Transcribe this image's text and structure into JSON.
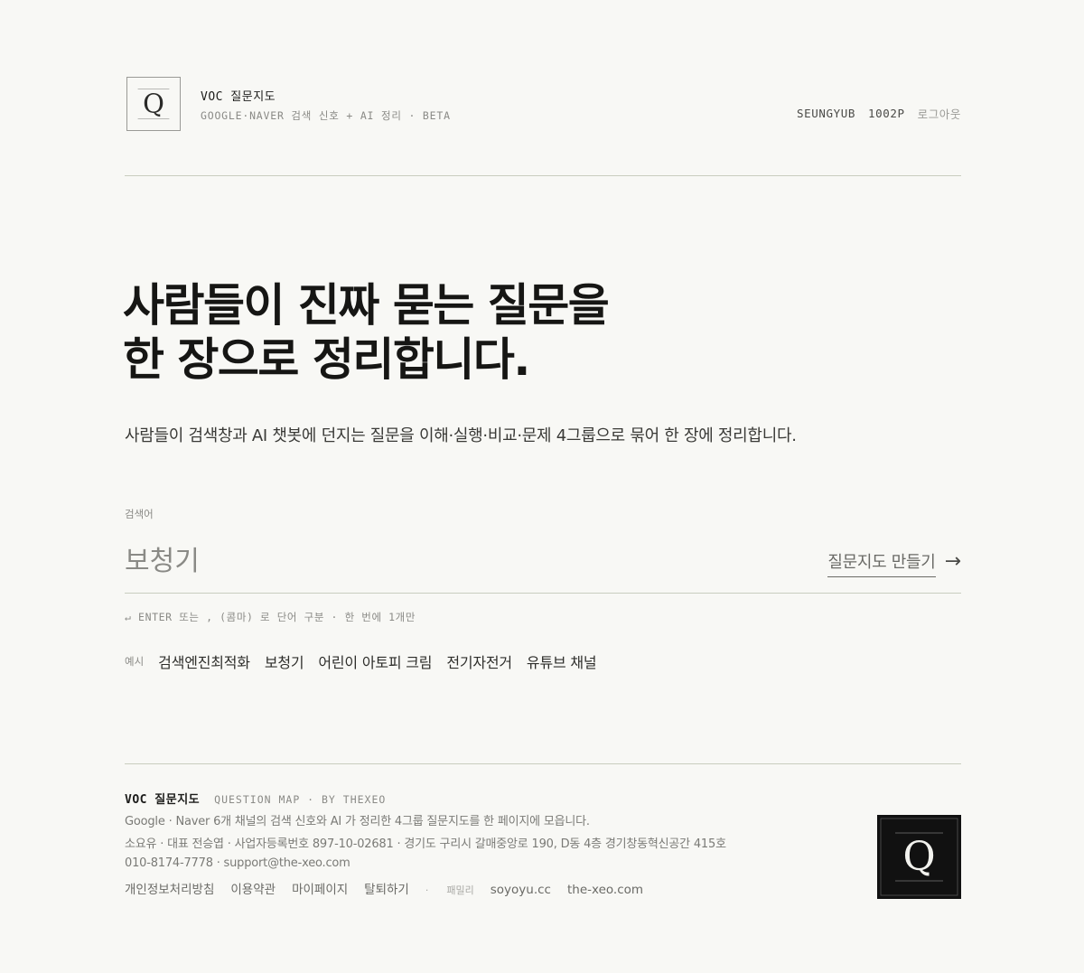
{
  "header": {
    "brand_title": "VOC  질문지도",
    "brand_subtitle": "GOOGLE·NAVER 검색 신호 + AI 정리 · BETA",
    "user_name": "SEUNGYUB",
    "user_points": "1002P",
    "logout_label": "로그아웃",
    "logo_letter": "Q"
  },
  "hero": {
    "title_line1": "사람들이 진짜 묻는 질문을",
    "title_line2": "한 장으로 정리합니다.",
    "description": "사람들이 검색창과 AI 챗봇에 던지는 질문을 이해·실행·비교·문제 4그룹으로 묶어 한 장에 정리합니다."
  },
  "search": {
    "label": "검색어",
    "value": "보청기",
    "button_label": "질문지도 만들기",
    "button_arrow": "→",
    "hint": "↵ ENTER 또는 , (콤마) 로 단어 구분 · 한 번에 1개만",
    "examples_label": "예시",
    "examples": [
      "검색엔진최적화",
      "보청기",
      "어린이 아토피 크림",
      "전기자전거",
      "유튜브 채널"
    ]
  },
  "footer": {
    "brand": "VOC 질문지도",
    "tagline": "QUESTION MAP · BY THEXEO",
    "line1": "Google · Naver 6개 채널의 검색 신호와 AI 가 정리한 4그룹 질문지도를 한 페이지에 모읍니다.",
    "line2": "소요유 · 대표 전승엽 · 사업자등록번호 897-10-02681 · 경기도 구리시 갈매중앙로 190, D동 4층 경기창동혁신공간 415호",
    "line3": "010-8174-7778 · support@the-xeo.com",
    "links": [
      "개인정보처리방침",
      "이용약관",
      "마이페이지",
      "탈퇴하기"
    ],
    "family_dot": "·",
    "family_label": "패밀리",
    "family_links": [
      "soyoyu.cc",
      "the-xeo.com"
    ],
    "logo_letter": "Q"
  }
}
